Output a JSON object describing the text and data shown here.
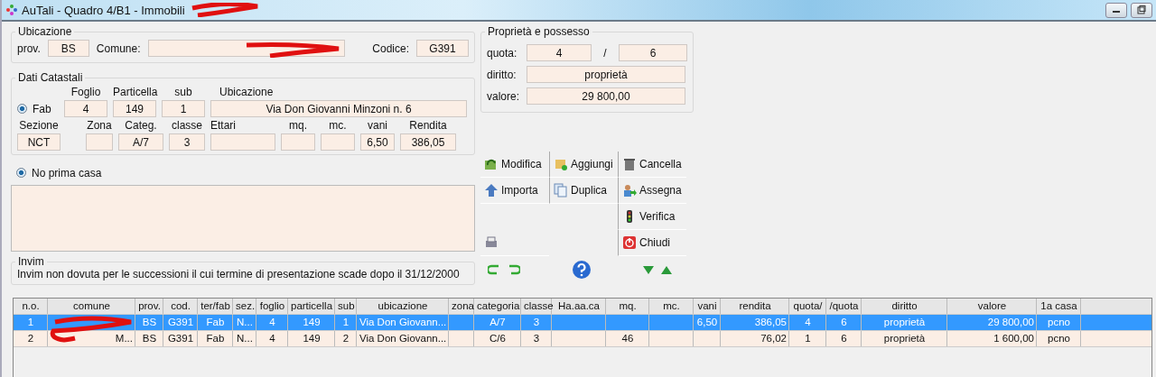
{
  "window": {
    "title": "AuTali - Quadro 4/B1 - Immobili"
  },
  "ubicazione": {
    "title": "Ubicazione",
    "prov_label": "prov.",
    "prov": "BS",
    "comune_label": "Comune:",
    "codice_label": "Codice:",
    "codice": "G391"
  },
  "catasto": {
    "title": "Dati Catastali",
    "fab": {
      "label": "Fab",
      "selected": true
    },
    "row1": [
      {
        "label": "Foglio",
        "value": "4"
      },
      {
        "label": "Particella",
        "value": "149"
      },
      {
        "label": "sub",
        "value": "1"
      },
      {
        "label": "Ubicazione",
        "value": "Via Don Giovanni Minzoni n. 6"
      }
    ],
    "row2": [
      {
        "label": "Sezione",
        "value": "NCT"
      },
      {
        "label": "Zona"
      },
      {
        "label": "Categ.",
        "value": "A/7"
      },
      {
        "label": "classe",
        "value": "3"
      },
      {
        "label": "Ettari"
      },
      {
        "label": "mq."
      },
      {
        "label": "mc."
      },
      {
        "label": "vani",
        "value": "6,50"
      },
      {
        "label": "Rendita",
        "value": "386,05"
      }
    ]
  },
  "possesso": {
    "title": "Proprietà e possesso",
    "quota_label": "quota:",
    "quota": "4",
    "slash": "/",
    "quota_den": "6",
    "diritto_label": "diritto:",
    "diritto": "proprietà",
    "valore_label": "valore:",
    "valore": "29 800,00"
  },
  "prima_casa": {
    "label": "No prima casa",
    "selected": true
  },
  "invim": {
    "title": "Invim",
    "text": "Invim non dovuta per le successioni il cui termine di presentazione scade dopo il 31/12/2000"
  },
  "actions": [
    "Modifica",
    "Aggiungi",
    "Cancella",
    "Importa",
    "Duplica",
    "Assegna",
    "Verifica",
    "Chiudi"
  ],
  "table": {
    "columns": [
      "n.o.",
      "comune",
      "prov.",
      "cod.",
      "ter/fab",
      "sez.",
      "foglio",
      "particella",
      "sub",
      "ubicazione",
      "zona",
      "categoria",
      "classe",
      "Ha.aa.ca",
      "mq.",
      "mc.",
      "vani",
      "rendita",
      "quota/",
      "/quota",
      "diritto",
      "valore",
      "1a casa"
    ],
    "rows": [
      {
        "selected": true,
        "cells": [
          "1",
          "",
          "BS",
          "G391",
          "Fab",
          "N...",
          "4",
          "149",
          "1",
          "Via Don Giovann...",
          "",
          "A/7",
          "3",
          "",
          "",
          "",
          "6,50",
          "386,05",
          "4",
          "6",
          "proprietà",
          "29 800,00",
          "pcno"
        ]
      },
      {
        "selected": false,
        "cells": [
          "2",
          "M...",
          "BS",
          "G391",
          "Fab",
          "N...",
          "4",
          "149",
          "2",
          "Via Don Giovann...",
          "",
          "C/6",
          "3",
          "",
          "46",
          "",
          "",
          "76,02",
          "1",
          "6",
          "proprietà",
          "1 600,00",
          "pcno"
        ]
      }
    ]
  }
}
